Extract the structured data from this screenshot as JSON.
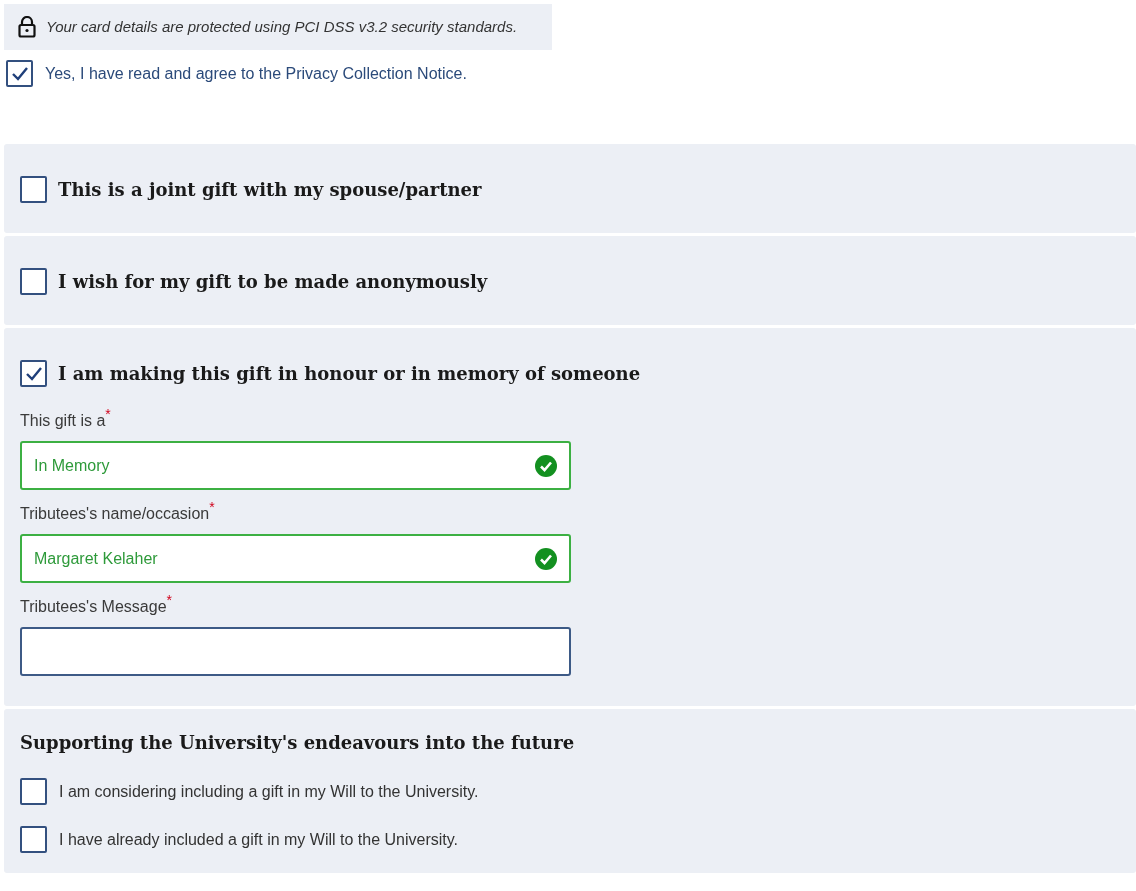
{
  "security_note": {
    "text": "Your card details are protected using PCI DSS v3.2 security standards."
  },
  "privacy_agreement": {
    "label": "Yes, I have read and agree to the Privacy Collection Notice.",
    "checked": true
  },
  "gift_options": [
    {
      "label": "This is a joint gift with my spouse/partner",
      "checked": false
    },
    {
      "label": "I wish for my gift to be made anonymously",
      "checked": false
    },
    {
      "label": "I am making this gift in honour or in memory of someone",
      "checked": true,
      "fields": [
        {
          "label": "This gift is a",
          "required_mark": "*",
          "value": "In Memory",
          "valid": true
        },
        {
          "label": "Tributees's name/occasion",
          "required_mark": "*",
          "value": "Margaret Kelaher",
          "valid": true
        },
        {
          "label": "Tributees's Message",
          "required_mark": "*",
          "valid": false
        }
      ]
    }
  ],
  "bequest_section": {
    "heading": "Supporting the University's endeavours into the future",
    "options": [
      {
        "label": "I am considering including a gift in my Will to the University.",
        "checked": false
      },
      {
        "label": "I have already included a gift in my Will to the University.",
        "checked": false
      }
    ]
  }
}
